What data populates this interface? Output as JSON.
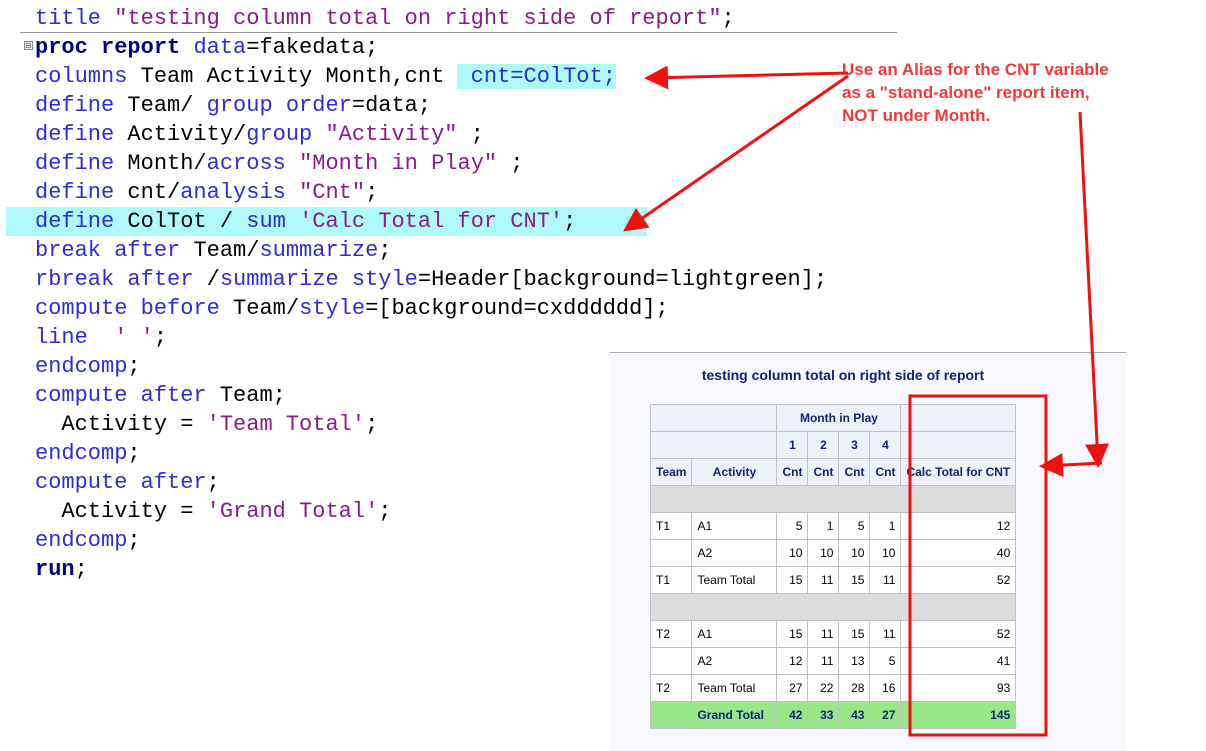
{
  "code": [
    {
      "hl": false,
      "tokens": [
        [
          "kw",
          "title "
        ],
        [
          "st",
          "\"testing column total on right side of report\""
        ],
        [
          "tx",
          ";"
        ]
      ]
    },
    {
      "hl": false,
      "tokens": [
        [
          "bd",
          "proc report "
        ],
        [
          "kw",
          "data"
        ],
        [
          "tx",
          "=fakedata;"
        ]
      ]
    },
    {
      "hl": false,
      "tokens": [
        [
          "kw",
          "columns "
        ],
        [
          "tx",
          "Team Activity Month,cnt "
        ],
        [
          "hlkw",
          " cnt=ColTot;"
        ]
      ]
    },
    {
      "hl": false,
      "tokens": [
        [
          "kw",
          "define "
        ],
        [
          "tx",
          "Team/ "
        ],
        [
          "kw",
          "group order"
        ],
        [
          "tx",
          "=data;"
        ]
      ]
    },
    {
      "hl": false,
      "tokens": [
        [
          "kw",
          "define "
        ],
        [
          "tx",
          "Activity/"
        ],
        [
          "kw",
          "group "
        ],
        [
          "st",
          "\"Activity\""
        ],
        [
          "tx",
          " ;"
        ]
      ]
    },
    {
      "hl": false,
      "tokens": [
        [
          "kw",
          "define "
        ],
        [
          "tx",
          "Month/"
        ],
        [
          "kw",
          "across "
        ],
        [
          "st",
          "\"Month in Play\""
        ],
        [
          "tx",
          " ;"
        ]
      ]
    },
    {
      "hl": false,
      "tokens": [
        [
          "kw",
          "define "
        ],
        [
          "tx",
          "cnt/"
        ],
        [
          "kw",
          "analysis "
        ],
        [
          "st",
          "\"Cnt\""
        ],
        [
          "tx",
          ";"
        ]
      ]
    },
    {
      "hl": true,
      "tokens": [
        [
          "kw",
          "define "
        ],
        [
          "tx",
          "ColTot / "
        ],
        [
          "kw",
          "sum "
        ],
        [
          "st",
          "'Calc Total for CNT'"
        ],
        [
          "tx",
          ";"
        ]
      ]
    },
    {
      "hl": false,
      "tokens": [
        [
          "kw",
          "break after "
        ],
        [
          "tx",
          "Team/"
        ],
        [
          "kw",
          "summarize"
        ],
        [
          "tx",
          ";"
        ]
      ]
    },
    {
      "hl": false,
      "tokens": [
        [
          "kw",
          "rbreak after "
        ],
        [
          "tx",
          "/"
        ],
        [
          "kw",
          "summarize style"
        ],
        [
          "tx",
          "=Header[background=lightgreen];"
        ]
      ]
    },
    {
      "hl": false,
      "tokens": [
        [
          "kw",
          "compute before "
        ],
        [
          "tx",
          "Team/"
        ],
        [
          "kw",
          "style"
        ],
        [
          "tx",
          "=[background=cxdddddd];"
        ]
      ]
    },
    {
      "hl": false,
      "tokens": [
        [
          "kw",
          "line "
        ],
        [
          "st",
          " ' '"
        ],
        [
          "tx",
          ";"
        ]
      ]
    },
    {
      "hl": false,
      "tokens": [
        [
          "kw",
          "endcomp"
        ],
        [
          "tx",
          ";"
        ]
      ]
    },
    {
      "hl": false,
      "tokens": [
        [
          "kw",
          "compute after "
        ],
        [
          "tx",
          "Team;"
        ]
      ]
    },
    {
      "hl": false,
      "tokens": [
        [
          "tx",
          "  Activity = "
        ],
        [
          "st",
          "'Team Total'"
        ],
        [
          "tx",
          ";"
        ]
      ]
    },
    {
      "hl": false,
      "tokens": [
        [
          "kw",
          "endcomp"
        ],
        [
          "tx",
          ";"
        ]
      ]
    },
    {
      "hl": false,
      "tokens": [
        [
          "kw",
          "compute after"
        ],
        [
          "tx",
          ";"
        ]
      ]
    },
    {
      "hl": false,
      "tokens": [
        [
          "tx",
          "  Activity = "
        ],
        [
          "st",
          "'Grand Total'"
        ],
        [
          "tx",
          ";"
        ]
      ]
    },
    {
      "hl": false,
      "tokens": [
        [
          "kw",
          "endcomp"
        ],
        [
          "tx",
          ";"
        ]
      ]
    },
    {
      "hl": false,
      "tokens": [
        [
          "bd",
          "run"
        ],
        [
          "tx",
          ";"
        ]
      ]
    }
  ],
  "fold_icon": "⊟",
  "note": [
    "Use an Alias for the CNT variable",
    "as a \"stand-alone\" report item,",
    "NOT under Month."
  ],
  "report": {
    "title": "testing column total on right side of report",
    "across_label": "Month in Play",
    "months": [
      "1",
      "2",
      "3",
      "4"
    ],
    "headers": {
      "team": "Team",
      "activity": "Activity",
      "cnt": "Cnt",
      "total": "Calc Total for CNT"
    },
    "rows": [
      {
        "type": "gap"
      },
      {
        "type": "d",
        "cells": [
          "T1",
          "A1",
          "5",
          "1",
          "5",
          "1",
          "12"
        ]
      },
      {
        "type": "d",
        "cells": [
          "",
          "A2",
          "10",
          "10",
          "10",
          "10",
          "40"
        ]
      },
      {
        "type": "d",
        "cells": [
          "T1",
          "Team Total",
          "15",
          "11",
          "15",
          "11",
          "52"
        ]
      },
      {
        "type": "gap"
      },
      {
        "type": "d",
        "cells": [
          "T2",
          "A1",
          "15",
          "11",
          "15",
          "11",
          "52"
        ]
      },
      {
        "type": "d",
        "cells": [
          "",
          "A2",
          "12",
          "11",
          "13",
          "5",
          "41"
        ]
      },
      {
        "type": "d",
        "cells": [
          "T2",
          "Team Total",
          "27",
          "22",
          "28",
          "16",
          "93"
        ]
      },
      {
        "type": "gt",
        "cells": [
          "",
          "Grand Total",
          "42",
          "33",
          "43",
          "27",
          "145"
        ]
      }
    ]
  },
  "colors": {
    "annotation": "#f02020",
    "grand_total_bg": "#98e88a",
    "highlight": "#aefafa"
  }
}
